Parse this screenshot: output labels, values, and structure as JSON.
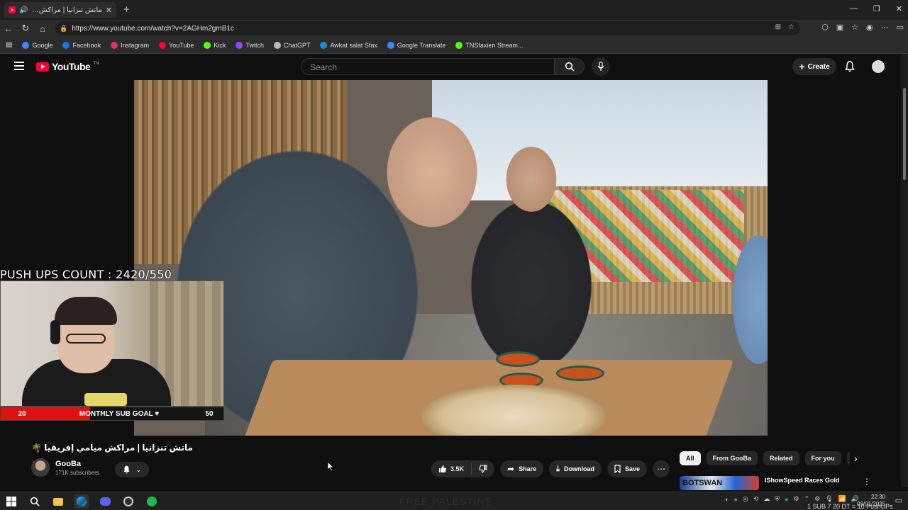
{
  "browser": {
    "tab_title": "ماتش تنزانيا | مراكش ميامي إفريقيا",
    "new_tab_icon": "plus-icon",
    "url": "https://www.youtube.com/watch?v=2AGHm2gmB1c",
    "bookmarks": [
      {
        "label": "Google",
        "color": "#4285f4"
      },
      {
        "label": "Facebook",
        "color": "#1877f2"
      },
      {
        "label": "Instagram",
        "color": "#e1306c"
      },
      {
        "label": "YouTube",
        "color": "#ff0033"
      },
      {
        "label": "Kick",
        "color": "#53fc18"
      },
      {
        "label": "Twitch",
        "color": "#9146ff"
      },
      {
        "label": "ChatGPT",
        "color": "#bbbbbb"
      },
      {
        "label": "Awkat salat Sfax",
        "color": "#1c8adb"
      },
      {
        "label": "Google Translate",
        "color": "#4285f4"
      },
      {
        "label": "TNSfaxien Stream...",
        "color": "#53fc18"
      }
    ]
  },
  "youtube": {
    "logo_text": "YouTube",
    "logo_sup": "TN",
    "search_placeholder": "Search",
    "create_label": "Create",
    "video": {
      "title": "ماتش تنزانيا | مراكش ميامي إفريقيا 🌴",
      "channel": "GooBa",
      "subscribers": "171K subscribers",
      "likes": "3.5K",
      "share_label": "Share",
      "download_label": "Download",
      "save_label": "Save"
    },
    "chips": [
      "All",
      "From GooBa",
      "Related",
      "For you",
      "Re"
    ],
    "recommendation": {
      "thumb_text": "BOTSWAN",
      "title": "IShowSpeed Races Gold Medalist Letsile Tebogo"
    }
  },
  "overlay": {
    "pushups": "PUSH UPS COUNT : 2420/550",
    "subgoal_current": "20",
    "subgoal_label": "MONTHLY SUB GOAL ♥",
    "subgoal_target": "50",
    "subgoal_progress": 0.4
  },
  "taskbar": {
    "watermark": "FREE PALESTINE",
    "time": "22:30",
    "date": "09/01/2025",
    "ticker": "1 SUB 7 20 DT = 10 PushUPs"
  },
  "colors": {
    "yt_red": "#ff0033",
    "bg": "#0f0f0f",
    "chip_bg": "#272727"
  }
}
